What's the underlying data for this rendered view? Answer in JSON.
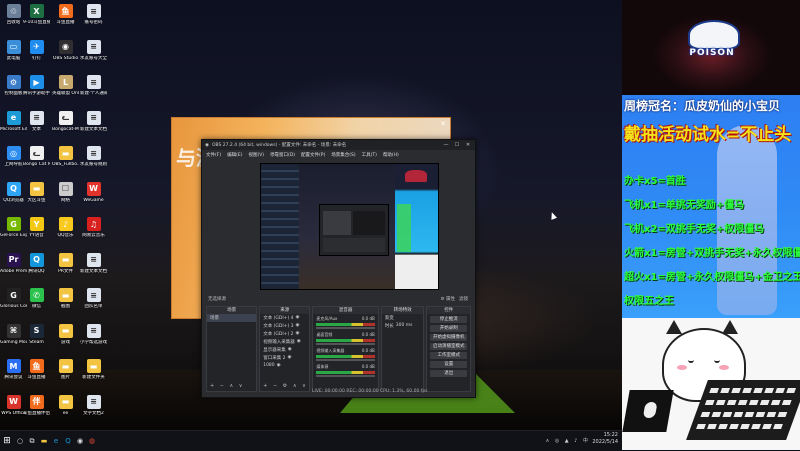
{
  "desktop": {
    "icons": [
      {
        "label": "回收站",
        "icon": "recycle-bin-icon",
        "color": "#6b7f99",
        "glyph": "♲"
      },
      {
        "label": "9-10斗鱼直播计划",
        "icon": "excel-file-icon",
        "color": "#1d6f42",
        "glyph": "X"
      },
      {
        "label": "斗鱼直播",
        "icon": "douyu-icon",
        "color": "#f26a1b",
        "glyph": "鱼"
      },
      {
        "label": "账号密码",
        "icon": "text-file-icon",
        "color": "#dfe5ee",
        "glyph": "≡"
      },
      {
        "label": "此电脑",
        "icon": "computer-icon",
        "color": "#3a8fd8",
        "glyph": "▭"
      },
      {
        "label": "钉钉",
        "icon": "dingtalk-icon",
        "color": "#1f8cf0",
        "glyph": "✈"
      },
      {
        "label": "OBS Studio",
        "icon": "obs-icon",
        "color": "#302e31",
        "glyph": "◉"
      },
      {
        "label": "水友账号大全",
        "icon": "text-file-icon",
        "color": "#dfe5ee",
        "glyph": "≡"
      },
      {
        "label": "控制面板",
        "icon": "control-panel-icon",
        "color": "#3b7cc9",
        "glyph": "⚙"
      },
      {
        "label": "腾讯手游助手",
        "icon": "game-assistant-icon",
        "color": "#1d8fe8",
        "glyph": "▶"
      },
      {
        "label": "英雄联盟 Online",
        "icon": "league-icon",
        "color": "#c8aa6e",
        "glyph": "L"
      },
      {
        "label": "新建·个人通知",
        "icon": "text-file-icon",
        "color": "#dfe5ee",
        "glyph": "≡"
      },
      {
        "label": "Microsoft Edge",
        "icon": "edge-icon",
        "color": "#1c9bd6",
        "glyph": "e"
      },
      {
        "label": "文本",
        "icon": "text-file-icon",
        "color": "#dfe5ee",
        "glyph": "≡"
      },
      {
        "label": "Bongocat-Mver",
        "icon": "bongocat-icon",
        "color": "#f0f0f0",
        "glyph": "ᓚ"
      },
      {
        "label": "新建文本文档",
        "icon": "text-file-icon",
        "color": "#dfe5ee",
        "glyph": "≡"
      },
      {
        "label": "上网导航",
        "icon": "browser-icon",
        "color": "#2d8ef0",
        "glyph": "◎"
      },
      {
        "label": "Bongo Cat Mver",
        "icon": "bongocat-icon",
        "color": "#f0f0f0",
        "glyph": "ᓚ"
      },
      {
        "label": "OBS_Fullbo...",
        "icon": "folder-icon",
        "color": "#f3c442",
        "glyph": "▬"
      },
      {
        "label": "水友账号规则",
        "icon": "text-file-icon",
        "color": "#dfe5ee",
        "glyph": "≡"
      },
      {
        "label": "QQ浏览器",
        "icon": "qq-browser-icon",
        "color": "#2fa6f5",
        "glyph": "Q"
      },
      {
        "label": "大区斗鱼",
        "icon": "folder-icon",
        "color": "#f3c442",
        "glyph": "▬"
      },
      {
        "label": "网络",
        "icon": "network-icon",
        "color": "#cccccc",
        "glyph": "☐"
      },
      {
        "label": "WeGame",
        "icon": "wegame-icon",
        "color": "#e2332d",
        "glyph": "W"
      },
      {
        "label": "GeForce Experience",
        "icon": "geforce-icon",
        "color": "#76b900",
        "glyph": "G"
      },
      {
        "label": "YY语音",
        "icon": "yy-icon",
        "color": "#f2c814",
        "glyph": "Y"
      },
      {
        "label": "QQ音乐",
        "icon": "qq-music-icon",
        "color": "#f9c91e",
        "glyph": "♪"
      },
      {
        "label": "网易云音乐",
        "icon": "netease-music-icon",
        "color": "#d8211f",
        "glyph": "♫"
      },
      {
        "label": "Adobe Premie...",
        "icon": "premiere-icon",
        "color": "#2a1250",
        "glyph": "Pr"
      },
      {
        "label": "腾讯QQ",
        "icon": "qq-icon",
        "color": "#1296db",
        "glyph": "Q"
      },
      {
        "label": "PR文件",
        "icon": "folder-icon",
        "color": "#f3c442",
        "glyph": "▬"
      },
      {
        "label": "新建文本文档(2)",
        "icon": "text-file-icon",
        "color": "#dfe5ee",
        "glyph": "≡"
      },
      {
        "label": "Glorious Core",
        "icon": "glorious-icon",
        "color": "#222",
        "glyph": "G"
      },
      {
        "label": "微信",
        "icon": "wechat-icon",
        "color": "#2bc24d",
        "glyph": "✆"
      },
      {
        "label": "截图",
        "icon": "folder-icon",
        "color": "#f3c442",
        "glyph": "▬"
      },
      {
        "label": "团队名单",
        "icon": "text-file-icon",
        "color": "#dfe5ee",
        "glyph": "≡"
      },
      {
        "label": "Gaming Mouse",
        "icon": "mouse-app-icon",
        "color": "#333",
        "glyph": "⌘"
      },
      {
        "label": "Steam",
        "icon": "steam-icon",
        "color": "#1b2838",
        "glyph": "S"
      },
      {
        "label": "游戏",
        "icon": "folder-icon",
        "color": "#f3c442",
        "glyph": "▬"
      },
      {
        "label": "小学帮选游戏的规则说明",
        "icon": "text-file-icon",
        "color": "#dfe5ee",
        "glyph": "≡"
      },
      {
        "label": "腾讯会议",
        "icon": "tencent-meeting-icon",
        "color": "#2a6ef3",
        "glyph": "M"
      },
      {
        "label": "斗鱼直播",
        "icon": "douyu-icon",
        "color": "#f26a1b",
        "glyph": "鱼"
      },
      {
        "label": "图片",
        "icon": "folder-icon",
        "color": "#f3c442",
        "glyph": "▬"
      },
      {
        "label": "新建文件夹",
        "icon": "folder-icon",
        "color": "#f3c442",
        "glyph": "▬"
      },
      {
        "label": "WPS Office",
        "icon": "wps-icon",
        "color": "#d9342b",
        "glyph": "W"
      },
      {
        "label": "斗鱼直播伴侣",
        "icon": "douyu-companion-icon",
        "color": "#f26a1b",
        "glyph": "伴"
      },
      {
        "label": "ee",
        "icon": "folder-icon",
        "color": "#f3c442",
        "glyph": "▬"
      },
      {
        "label": "文字文档2",
        "icon": "text-file-icon",
        "color": "#dfe5ee",
        "glyph": "≡"
      }
    ]
  },
  "orange_window": {
    "title_text": "与渊 应",
    "close": "✕"
  },
  "obs": {
    "title": "OBS 27.2.4 (64 bit, windows) - 配置文件: 未命名 - 场景: 未命名",
    "min": "—",
    "max": "☐",
    "close": "✕",
    "menu": [
      "文件(F)",
      "编辑(E)",
      "视图(V)",
      "停靠窗口(D)",
      "配置文件(P)",
      "场景集合(S)",
      "工具(T)",
      "帮助(H)"
    ],
    "scene_label": "无选择源",
    "scene_props": "⚙ 属性",
    "scene_filters": "滤镜",
    "docks": {
      "scenes": {
        "title": "场景",
        "items": [
          "场景"
        ],
        "controls": "+ − ∧ ∨"
      },
      "sources": {
        "title": "来源",
        "items": [
          "文本 (GDI+) 4",
          "文本 (GDI+) 3",
          "文本 (GDI+) 2",
          "视频输入采集器",
          "显示器采集",
          "窗口采集 2",
          "1080"
        ],
        "controls": "+ − ⚙ ∧ ∨"
      },
      "mixer": {
        "title": "混音器",
        "rows": [
          {
            "name": "麦克风/Aux",
            "db": "0.0 dB"
          },
          {
            "name": "桌面音频",
            "db": "0.0 dB"
          },
          {
            "name": "视频输入采集器",
            "db": "0.0 dB"
          },
          {
            "name": "媒体源",
            "db": "0.0 dB"
          }
        ]
      },
      "transitions": {
        "title": "转场特效",
        "type": "渐变",
        "duration_label": "时长",
        "duration": "300 ms"
      },
      "controls": {
        "title": "控件",
        "buttons": [
          "停止推流",
          "开始录制",
          "开始虚拟摄像机",
          "启动演播室模式",
          "工作室模式",
          "设置",
          "退出"
        ]
      }
    },
    "status": "LIVE: 00:00:00   REC: 00:00:00   CPU: 1.3%, 60.00 fps"
  },
  "stream": {
    "logo_text": "POISON",
    "crown": "周榜冠名：瓜皮奶仙的小宝贝",
    "headline": "戴抽活动试水=不止头",
    "rules": [
      "办卡x5=首胜",
      "飞机x1=单挑无奖励+僵马",
      "飞机x2=双挑手无奖+权限僵马",
      "火箭x1=房管+双挑手无奖+永久权限僵马",
      "超火x1=房管+永久权限僵马+金卫之王",
      "权限五之王"
    ]
  },
  "taskbar": {
    "start": "⊞",
    "apps": [
      {
        "icon": "search-icon",
        "glyph": "○",
        "color": "#ddd"
      },
      {
        "icon": "task-view-icon",
        "glyph": "⧉",
        "color": "#ddd"
      },
      {
        "icon": "explorer-icon",
        "glyph": "▬",
        "color": "#f3c442"
      },
      {
        "icon": "edge-taskbar-icon",
        "glyph": "e",
        "color": "#1c9bd6"
      },
      {
        "icon": "qq-taskbar-icon",
        "glyph": "Q",
        "color": "#1296db"
      },
      {
        "icon": "obs-taskbar-icon",
        "glyph": "◉",
        "color": "#ddd"
      },
      {
        "icon": "chrome-taskbar-icon",
        "glyph": "◍",
        "color": "#e84a3c"
      }
    ],
    "tray_icons": "∧ ◎ ▲ ♪ 中",
    "time": "15:22",
    "date": "2022/5/14"
  }
}
